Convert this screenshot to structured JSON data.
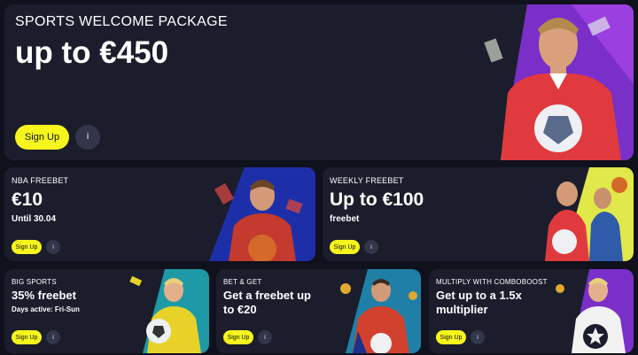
{
  "hero": {
    "eyebrow": "SPORTS WELCOME PACKAGE",
    "amount": "up to €450",
    "button": "Sign Up",
    "info_icon": "info-icon"
  },
  "nba": {
    "eyebrow": "NBA FREEBET",
    "amount": "€10",
    "sub": "Until 30.04",
    "button": "Sign Up"
  },
  "weekly": {
    "eyebrow": "WEEKLY FREEBET",
    "amount": "Up to €100",
    "sub": "freebet",
    "button": "Sign Up"
  },
  "bigsports": {
    "eyebrow": "BIG SPORTS",
    "title": "35% freebet",
    "sub": "Days active: Fri-Sun",
    "button": "Sign Up"
  },
  "betget": {
    "eyebrow": "BET & GET",
    "title_line1": "Get a freebet up",
    "title_line2": "to €20",
    "button": "Sign Up"
  },
  "combo": {
    "eyebrow": "MULTIPLY WITH COMBOBOOST",
    "title_line1": "Get up to a 1.5x",
    "title_line2": "multiplier",
    "button": "Sign Up"
  },
  "colors": {
    "background": "#0f111c",
    "card": "#1b1d2c",
    "button": "#f6f51d",
    "accent_purple": "#7a2fc9",
    "accent_blue": "#1d2fa8",
    "accent_teal": "#1e9aa6",
    "accent_yellow": "#e0e84a"
  }
}
